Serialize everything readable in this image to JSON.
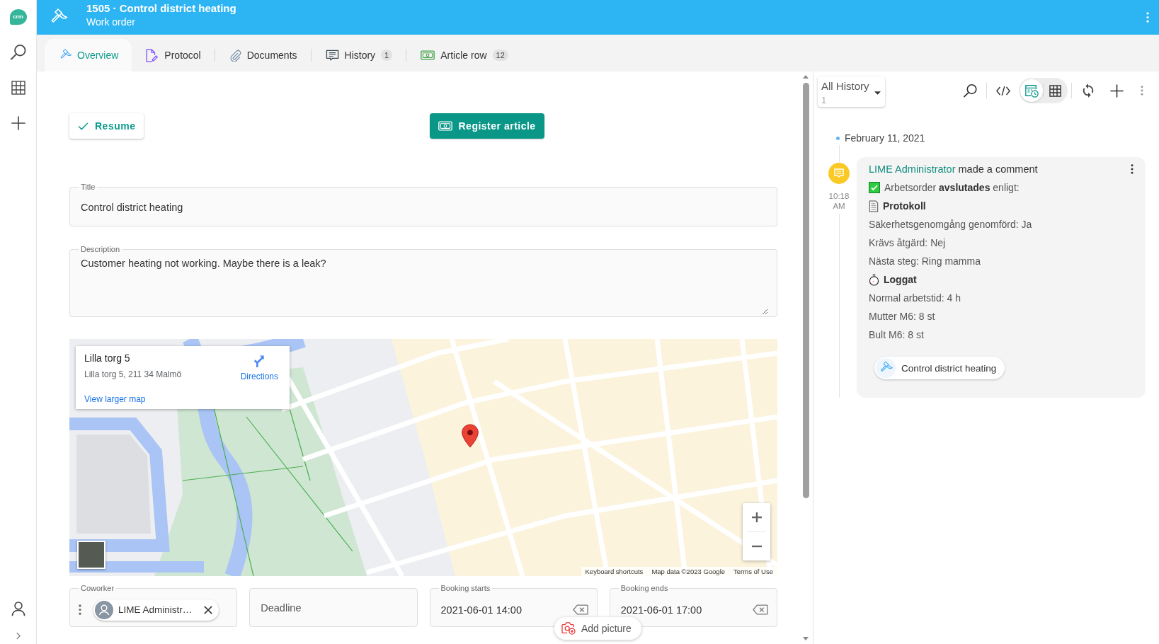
{
  "app": {
    "logo_text": "crm"
  },
  "header": {
    "title": "1505 · Control district heating",
    "subtitle": "Work order"
  },
  "tabs": [
    {
      "label": "Overview",
      "selected": true
    },
    {
      "label": "Protocol",
      "selected": false
    },
    {
      "label": "Documents",
      "selected": false
    },
    {
      "label": "History",
      "count": "1",
      "selected": false
    },
    {
      "label": "Article row",
      "count": "12",
      "selected": false
    }
  ],
  "form": {
    "actions": [
      {
        "kind": "outlined",
        "label": "Resume"
      },
      {
        "kind": "filled",
        "label": "Register article"
      }
    ],
    "title": {
      "label": "Title",
      "value": "Control district heating"
    },
    "description": {
      "label": "Description",
      "value": "Customer heating not working. Maybe there is a leak?"
    },
    "map": {
      "place": "Lilla torg 5",
      "address": "Lilla torg 5, 211 34 Malmö",
      "directions": "Directions",
      "larger_map_link": "View larger map",
      "attribution": [
        "Keyboard shortcuts",
        "Map data ©2023 Google",
        "Terms of Use"
      ]
    },
    "fields": [
      {
        "kind": "people",
        "label": "Coworker",
        "chips": [
          "LIME Administr…"
        ]
      },
      {
        "kind": "datetime",
        "placeholder": "Deadline"
      },
      {
        "kind": "datetime",
        "label": "Booking starts",
        "value": "2021-06-01 14:00"
      },
      {
        "kind": "datetime",
        "label": "Booking ends",
        "value": "2021-06-01 17:00"
      }
    ],
    "add_picture": "Add picture"
  },
  "history": {
    "filter": {
      "label": "All History",
      "count": "1"
    },
    "view_modes": [
      {
        "selected": true
      },
      {
        "selected": false
      }
    ],
    "date": "February 11, 2021",
    "entries": [
      {
        "kind": "comment",
        "time": "10:18 AM",
        "author": "LIME Administrator",
        "action": "made a comment",
        "lines": [
          {
            "kind": "checked",
            "text": "Arbetsorder **avslutades** enligt:"
          },
          {
            "kind": "document",
            "text": "Protokoll"
          },
          {
            "kind": "plain",
            "text": "Säkerhetsgenomgång genomförd: Ja"
          },
          {
            "kind": "plain",
            "text": "Krävs åtgärd: Nej"
          },
          {
            "kind": "plain",
            "text": "Nästa steg: Ring mamma"
          },
          {
            "kind": "timer",
            "text": "Loggat"
          },
          {
            "kind": "plain",
            "text": "Normal arbetstid: 4 h"
          },
          {
            "kind": "plain",
            "text": "Mutter M6: 8 st"
          },
          {
            "kind": "plain",
            "text": "Bult M6: 8 st"
          }
        ],
        "link": "Control district heating"
      }
    ]
  }
}
